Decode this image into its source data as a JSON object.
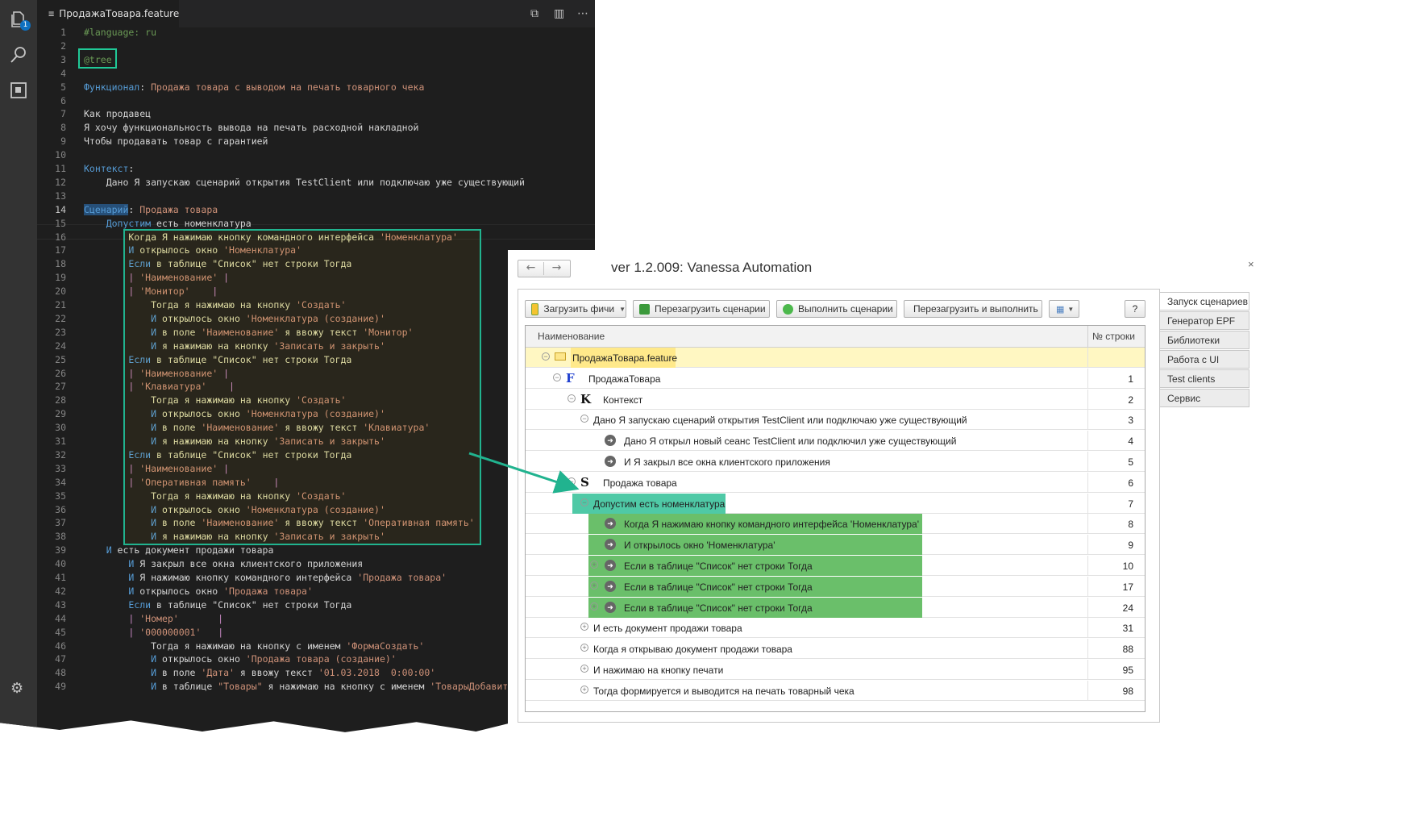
{
  "editor": {
    "tab_title": "ПродажаТовара.feature",
    "activity_badge": "1",
    "lines": [
      {
        "n": "1",
        "segs": [
          [
            "cm",
            "#language: ru"
          ]
        ]
      },
      {
        "n": "2",
        "segs": []
      },
      {
        "n": "3",
        "segs": [
          [
            "cm",
            "@tree"
          ]
        ]
      },
      {
        "n": "4",
        "segs": []
      },
      {
        "n": "5",
        "segs": [
          [
            "kw",
            "Функционал"
          ],
          [
            "tx",
            ": "
          ],
          [
            "st",
            "Продажа товара с выводом на печать товарного чека"
          ]
        ]
      },
      {
        "n": "6",
        "segs": []
      },
      {
        "n": "7",
        "segs": [
          [
            "tx",
            "Как продавец"
          ]
        ]
      },
      {
        "n": "8",
        "segs": [
          [
            "tx",
            "Я хочу функциональность вывода на печать расходной накладной"
          ]
        ]
      },
      {
        "n": "9",
        "segs": [
          [
            "tx",
            "Чтобы продавать товар с гарантией"
          ]
        ]
      },
      {
        "n": "10",
        "segs": []
      },
      {
        "n": "11",
        "segs": [
          [
            "kw",
            "Контекст"
          ],
          [
            "tx",
            ":"
          ]
        ]
      },
      {
        "n": "12",
        "segs": [
          [
            "tx",
            "    Дано Я запускаю сценарий открытия TestClient или подключаю уже существующий"
          ]
        ]
      },
      {
        "n": "13",
        "segs": []
      },
      {
        "n": "14",
        "segs": [
          [
            "kw",
            "Сценарий"
          ],
          [
            "tx",
            ": "
          ],
          [
            "st",
            "Продажа товара"
          ]
        ]
      },
      {
        "n": "15",
        "segs": [
          [
            "kw",
            "    Допустим"
          ],
          [
            "tx",
            " есть номенклатура"
          ]
        ]
      },
      {
        "n": "16",
        "segs": [
          [
            "yl",
            "        Когда Я нажимаю кнопку командного интерфейса "
          ],
          [
            "st",
            "'Номенклатура'"
          ]
        ]
      },
      {
        "n": "17",
        "segs": [
          [
            "kw",
            "        И"
          ],
          [
            "yl",
            " открылось окно "
          ],
          [
            "st",
            "'Номенклатура'"
          ]
        ]
      },
      {
        "n": "18",
        "segs": [
          [
            "kw",
            "        Если"
          ],
          [
            "yl",
            " в таблице \"Список\" нет строки Тогда"
          ]
        ]
      },
      {
        "n": "19",
        "segs": [
          [
            "pp",
            "        | "
          ],
          [
            "st",
            "'Наименование'"
          ],
          [
            "pp",
            " |"
          ]
        ]
      },
      {
        "n": "20",
        "segs": [
          [
            "pp",
            "        | "
          ],
          [
            "st",
            "'Монитор'"
          ],
          [
            "pp",
            "    |"
          ]
        ]
      },
      {
        "n": "21",
        "segs": [
          [
            "yl",
            "            Тогда я нажимаю на кнопку "
          ],
          [
            "st",
            "'Создать'"
          ]
        ]
      },
      {
        "n": "22",
        "segs": [
          [
            "kw",
            "            И"
          ],
          [
            "yl",
            " открылось окно "
          ],
          [
            "st",
            "'Номенклатура (создание)'"
          ]
        ]
      },
      {
        "n": "23",
        "segs": [
          [
            "kw",
            "            И"
          ],
          [
            "yl",
            " в поле "
          ],
          [
            "st",
            "'Наименование'"
          ],
          [
            "yl",
            " я ввожу текст "
          ],
          [
            "st",
            "'Монитор'"
          ]
        ]
      },
      {
        "n": "24",
        "segs": [
          [
            "kw",
            "            И"
          ],
          [
            "yl",
            " я нажимаю на кнопку "
          ],
          [
            "st",
            "'Записать и закрыть'"
          ]
        ]
      },
      {
        "n": "25",
        "segs": [
          [
            "kw",
            "        Если"
          ],
          [
            "yl",
            " в таблице \"Список\" нет строки Тогда"
          ]
        ]
      },
      {
        "n": "26",
        "segs": [
          [
            "pp",
            "        | "
          ],
          [
            "st",
            "'Наименование'"
          ],
          [
            "pp",
            " |"
          ]
        ]
      },
      {
        "n": "27",
        "segs": [
          [
            "pp",
            "        | "
          ],
          [
            "st",
            "'Клавиатура'"
          ],
          [
            "pp",
            "    |"
          ]
        ]
      },
      {
        "n": "28",
        "segs": [
          [
            "yl",
            "            Тогда я нажимаю на кнопку "
          ],
          [
            "st",
            "'Создать'"
          ]
        ]
      },
      {
        "n": "29",
        "segs": [
          [
            "kw",
            "            И"
          ],
          [
            "yl",
            " открылось окно "
          ],
          [
            "st",
            "'Номенклатура (создание)'"
          ]
        ]
      },
      {
        "n": "30",
        "segs": [
          [
            "kw",
            "            И"
          ],
          [
            "yl",
            " в поле "
          ],
          [
            "st",
            "'Наименование'"
          ],
          [
            "yl",
            " я ввожу текст "
          ],
          [
            "st",
            "'Клавиатура'"
          ]
        ]
      },
      {
        "n": "31",
        "segs": [
          [
            "kw",
            "            И"
          ],
          [
            "yl",
            " я нажимаю на кнопку "
          ],
          [
            "st",
            "'Записать и закрыть'"
          ]
        ]
      },
      {
        "n": "32",
        "segs": [
          [
            "kw",
            "        Если"
          ],
          [
            "yl",
            " в таблице \"Список\" нет строки Тогда"
          ]
        ]
      },
      {
        "n": "33",
        "segs": [
          [
            "pp",
            "        | "
          ],
          [
            "st",
            "'Наименование'"
          ],
          [
            "pp",
            " |"
          ]
        ]
      },
      {
        "n": "34",
        "segs": [
          [
            "pp",
            "        | "
          ],
          [
            "st",
            "'Оперативная память'"
          ],
          [
            "pp",
            "    |"
          ]
        ]
      },
      {
        "n": "35",
        "segs": [
          [
            "yl",
            "            Тогда я нажимаю на кнопку "
          ],
          [
            "st",
            "'Создать'"
          ]
        ]
      },
      {
        "n": "36",
        "segs": [
          [
            "kw",
            "            И"
          ],
          [
            "yl",
            " открылось окно "
          ],
          [
            "st",
            "'Номенклатура (создание)'"
          ]
        ]
      },
      {
        "n": "37",
        "segs": [
          [
            "kw",
            "            И"
          ],
          [
            "yl",
            " в поле "
          ],
          [
            "st",
            "'Наименование'"
          ],
          [
            "yl",
            " я ввожу текст "
          ],
          [
            "st",
            "'Оперативная память'"
          ]
        ]
      },
      {
        "n": "38",
        "segs": [
          [
            "kw",
            "            И"
          ],
          [
            "yl",
            " я нажимаю на кнопку "
          ],
          [
            "st",
            "'Записать и закрыть'"
          ]
        ]
      },
      {
        "n": "39",
        "segs": [
          [
            "kw",
            "    И"
          ],
          [
            "tx",
            " есть документ продажи товара"
          ]
        ]
      },
      {
        "n": "40",
        "segs": [
          [
            "kw",
            "        И"
          ],
          [
            "tx",
            " Я закрыл все окна клиентского приложения"
          ]
        ]
      },
      {
        "n": "41",
        "segs": [
          [
            "kw",
            "        И"
          ],
          [
            "tx",
            " Я нажимаю кнопку командного интерфейса "
          ],
          [
            "st",
            "'Продажа товара'"
          ]
        ]
      },
      {
        "n": "42",
        "segs": [
          [
            "kw",
            "        И"
          ],
          [
            "tx",
            " открылось окно "
          ],
          [
            "st",
            "'Продажа товара'"
          ]
        ]
      },
      {
        "n": "43",
        "segs": [
          [
            "kw",
            "        Если"
          ],
          [
            "tx",
            " в таблице \"Список\" нет строки Тогда"
          ]
        ]
      },
      {
        "n": "44",
        "segs": [
          [
            "pp",
            "        | "
          ],
          [
            "st",
            "'Номер'"
          ],
          [
            "pp",
            "       |"
          ]
        ]
      },
      {
        "n": "45",
        "segs": [
          [
            "pp",
            "        | "
          ],
          [
            "st",
            "'000000001'"
          ],
          [
            "pp",
            "   |"
          ]
        ]
      },
      {
        "n": "46",
        "segs": [
          [
            "tx",
            "            Тогда я нажимаю на кнопку с именем "
          ],
          [
            "st",
            "'ФормаСоздать'"
          ]
        ]
      },
      {
        "n": "47",
        "segs": [
          [
            "kw",
            "            И"
          ],
          [
            "tx",
            " открылось окно "
          ],
          [
            "st",
            "'Продажа товара (создание)'"
          ]
        ]
      },
      {
        "n": "48",
        "segs": [
          [
            "kw",
            "            И"
          ],
          [
            "tx",
            " в поле "
          ],
          [
            "st",
            "'Дата'"
          ],
          [
            "tx",
            " я ввожу текст "
          ],
          [
            "st",
            "'01.03.2018  0:00:00'"
          ]
        ]
      },
      {
        "n": "49",
        "segs": [
          [
            "kw",
            "            И"
          ],
          [
            "tx",
            " в таблице "
          ],
          [
            "st",
            "\"Товары\""
          ],
          [
            "tx",
            " я нажимаю на кнопку с именем "
          ],
          [
            "st",
            "'ТоварыДобавить'"
          ]
        ]
      }
    ]
  },
  "vanessa": {
    "title": "ver 1.2.009: Vanessa Automation",
    "close_glyph": "×",
    "nav_back": "←",
    "nav_forward": "→",
    "toolbar": {
      "load": "Загрузить фичи",
      "reload": "Перезагрузить сценарии",
      "run": "Выполнить сценарии",
      "reload_run": "Перезагрузить и выполнить",
      "help": "?"
    },
    "columns": {
      "name": "Наименование",
      "line_no": "№ строки"
    },
    "rows": [
      {
        "text": "ПродажаТовара.feature",
        "num": ""
      },
      {
        "text": "ПродажаТовара",
        "num": "1",
        "icon": "F"
      },
      {
        "text": "Контекст",
        "num": "2",
        "icon": "K"
      },
      {
        "text": "Дано Я запускаю сценарий открытия TestClient или подключаю уже существующий",
        "num": "3"
      },
      {
        "text": "Дано Я открыл новый сеанс TestClient или подключил уже существующий",
        "num": "4"
      },
      {
        "text": "И    Я закрыл все окна клиентского приложения",
        "num": "5"
      },
      {
        "text": "Продажа товара",
        "num": "6",
        "icon": "S"
      },
      {
        "text": "Допустим есть номенклатура",
        "num": "7"
      },
      {
        "text": "Когда Я нажимаю кнопку командного интерфейса 'Номенклатура'",
        "num": "8"
      },
      {
        "text": "И открылось окно 'Номенклатура'",
        "num": "9"
      },
      {
        "text": "Если в таблице \"Список\" нет строки Тогда",
        "num": "10"
      },
      {
        "text": "Если в таблице \"Список\" нет строки Тогда",
        "num": "17"
      },
      {
        "text": "Если в таблице \"Список\" нет строки Тогда",
        "num": "24"
      },
      {
        "text": "И есть документ продажи товара",
        "num": "31"
      },
      {
        "text": "Когда я открываю документ продажи товара",
        "num": "88"
      },
      {
        "text": "И нажимаю на кнопку печати",
        "num": "95"
      },
      {
        "text": "Тогда формируется и выводится на печать товарный чека",
        "num": "98"
      }
    ],
    "sidebar": [
      "Запуск сценариев",
      "Генератор EPF",
      "Библиотеки",
      "Работа с UI",
      "Test clients",
      "Сервис"
    ]
  },
  "colors": {
    "highlight_yellow": "#ffe98a",
    "highlight_teal": "#4fc9a6",
    "highlight_green": "#6abf6a",
    "accent": "#21b38f"
  }
}
